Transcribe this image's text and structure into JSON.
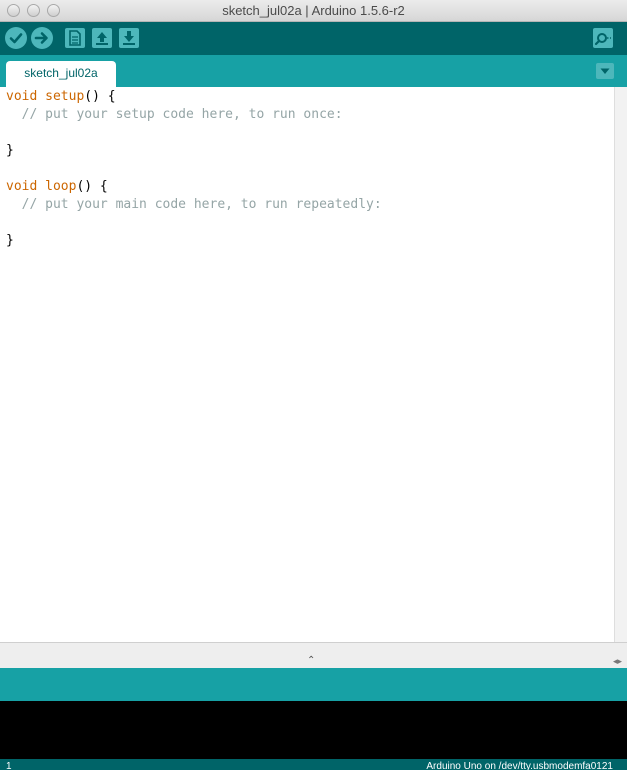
{
  "window": {
    "title": "sketch_jul02a | Arduino 1.5.6-r2"
  },
  "toolbar": {
    "buttons": [
      {
        "name": "verify",
        "icon": "check-icon"
      },
      {
        "name": "upload",
        "icon": "arrow-right-icon"
      },
      {
        "name": "new",
        "icon": "document-icon"
      },
      {
        "name": "open",
        "icon": "arrow-up-icon"
      },
      {
        "name": "save",
        "icon": "arrow-down-icon"
      },
      {
        "name": "serial-monitor",
        "icon": "magnifier-icon"
      }
    ]
  },
  "tabs": {
    "active": "sketch_jul02a",
    "menu_icon": "triangle-down-icon"
  },
  "editor": {
    "lines": [
      [
        {
          "t": "void ",
          "c": "kw"
        },
        {
          "t": "setup",
          "c": "kw"
        },
        {
          "t": "() {",
          "c": "pl"
        }
      ],
      [
        {
          "t": "  // put your setup code here, to run once:",
          "c": "cm"
        }
      ],
      [],
      [
        {
          "t": "}",
          "c": "pl"
        }
      ],
      [],
      [
        {
          "t": "void ",
          "c": "kw"
        },
        {
          "t": "loop",
          "c": "kw"
        },
        {
          "t": "() {",
          "c": "pl"
        }
      ],
      [
        {
          "t": "  // put your main code here, to run repeatedly:",
          "c": "cm"
        }
      ],
      [],
      [
        {
          "t": "}",
          "c": "pl"
        }
      ]
    ]
  },
  "footer": {
    "line_number": "1",
    "board_port": "Arduino Uno on /dev/tty.usbmodemfa0121"
  },
  "colors": {
    "toolbar_bg": "#006468",
    "tabbar_bg": "#17a1a5",
    "button_bg": "#4db7bb",
    "keyword": "#cc6600",
    "comment": "#95a5a6",
    "console_bg": "#000000"
  }
}
